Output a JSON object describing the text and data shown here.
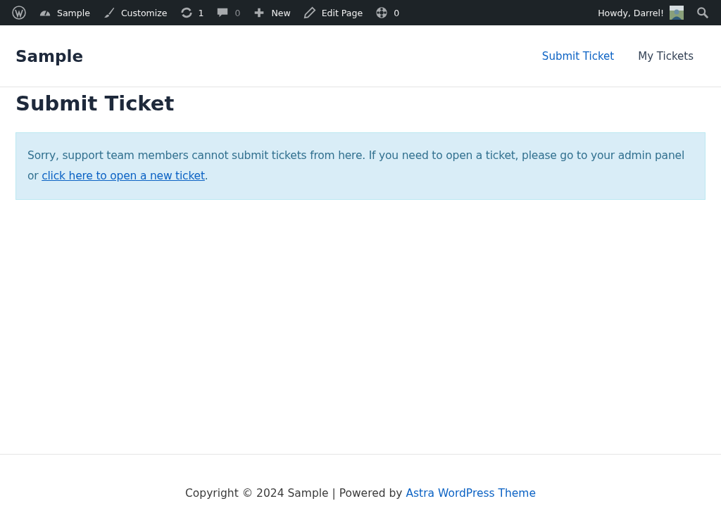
{
  "admin_bar": {
    "items": [
      {
        "kind": "logo"
      },
      {
        "kind": "dashboard",
        "label": "Sample",
        "disabled": false
      },
      {
        "kind": "brush",
        "label": "Customize",
        "disabled": false
      },
      {
        "kind": "updates",
        "label": "1",
        "disabled": false
      },
      {
        "kind": "comments",
        "label": "0",
        "disabled": true
      },
      {
        "kind": "plus",
        "label": "New",
        "disabled": false
      },
      {
        "kind": "pencil",
        "label": "Edit Page",
        "disabled": false
      },
      {
        "kind": "support",
        "label": "0",
        "disabled": false
      }
    ],
    "greeting": "Howdy, Darrel!"
  },
  "site": {
    "title": "Sample",
    "nav": [
      {
        "label": "Submit Ticket",
        "selected": true
      },
      {
        "label": "My Tickets",
        "selected": false
      }
    ]
  },
  "page": {
    "title": "Submit Ticket",
    "notice": {
      "before": "Sorry, support team members cannot submit tickets from here. If you need to open a ticket, please go to your admin panel or ",
      "link": "click here to open a new ticket",
      "after": "."
    }
  },
  "footer": {
    "text": "Copyright © 2024 Sample | Powered by ",
    "link": "Astra WordPress Theme"
  }
}
